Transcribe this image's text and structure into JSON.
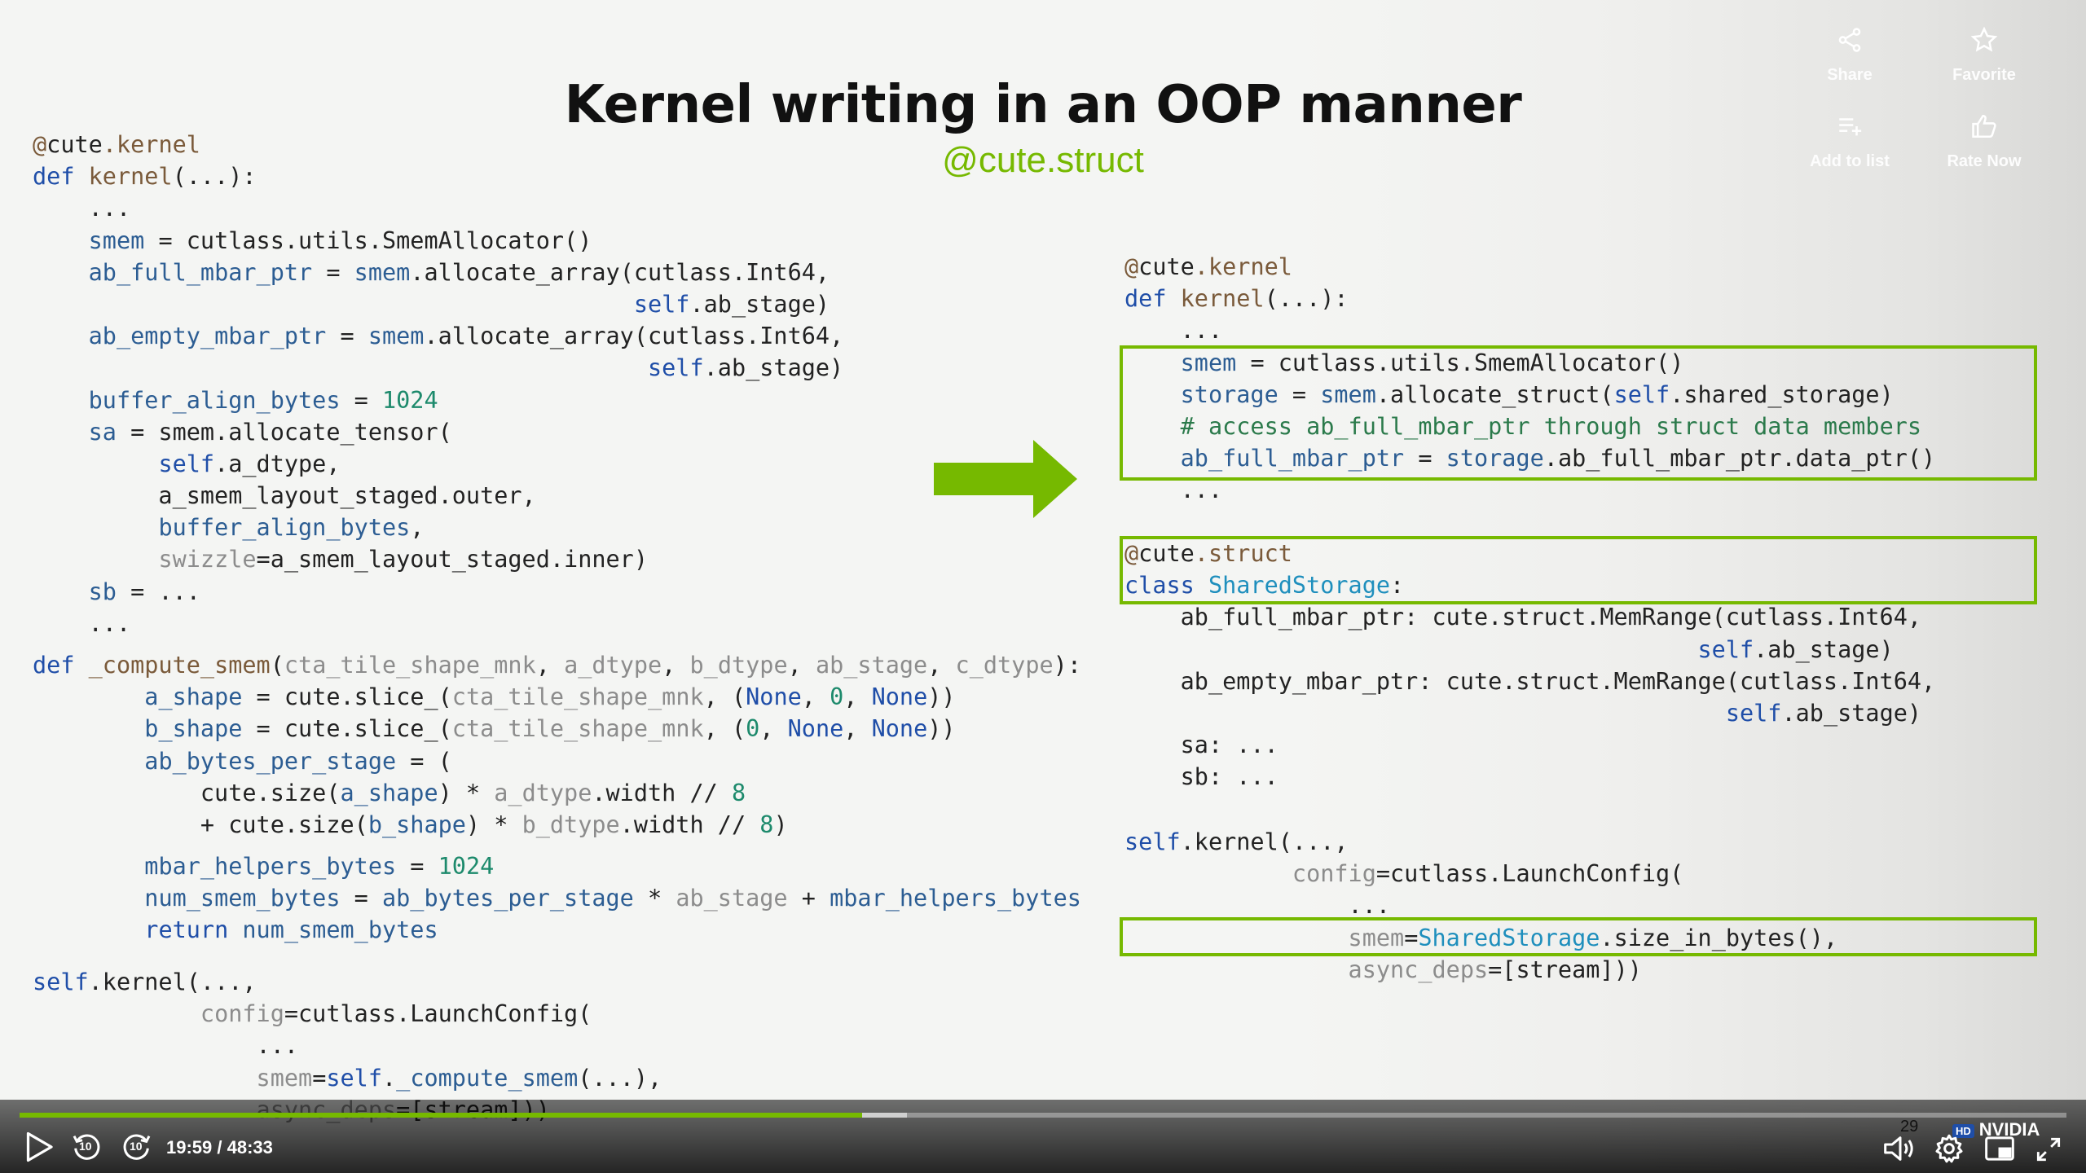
{
  "slide": {
    "title": "Kernel writing in an OOP manner",
    "subtitle": "@cute.struct",
    "number": "29"
  },
  "left_code": [
    [
      [
        "@",
        "c-dec"
      ],
      [
        "cute",
        "c-dec-none"
      ],
      [
        ".kernel",
        "c-dec"
      ]
    ],
    [
      [
        "def ",
        "c-kw"
      ],
      [
        "kernel",
        "c-fn"
      ],
      [
        "(...):",
        ""
      ]
    ],
    [
      [
        "    ...",
        ""
      ]
    ],
    [
      [
        "    ",
        ""
      ],
      [
        "smem",
        "c-var"
      ],
      [
        " = cutlass.utils.SmemAllocator()",
        ""
      ]
    ],
    [
      [
        "    ",
        ""
      ],
      [
        "ab_full_mbar_ptr",
        "c-var"
      ],
      [
        " = ",
        ""
      ],
      [
        "smem",
        "c-var"
      ],
      [
        ".allocate_array(cutlass.Int64,",
        ""
      ]
    ],
    [
      [
        "                                           ",
        ""
      ],
      [
        "self",
        "c-self"
      ],
      [
        ".ab_stage)",
        ""
      ]
    ],
    [
      [
        "    ",
        ""
      ],
      [
        "ab_empty_mbar_ptr",
        "c-var"
      ],
      [
        " = ",
        ""
      ],
      [
        "smem",
        "c-var"
      ],
      [
        ".allocate_array(cutlass.Int64,",
        ""
      ]
    ],
    [
      [
        "                                            ",
        ""
      ],
      [
        "self",
        "c-self"
      ],
      [
        ".ab_stage)",
        ""
      ]
    ],
    [
      [
        "    ",
        ""
      ],
      [
        "buffer_align_bytes",
        "c-var"
      ],
      [
        " = ",
        ""
      ],
      [
        "1024",
        "c-num"
      ]
    ],
    [
      [
        "    ",
        ""
      ],
      [
        "sa",
        "c-var"
      ],
      [
        " = smem.allocate_tensor(",
        ""
      ]
    ],
    [
      [
        "         ",
        ""
      ],
      [
        "self",
        "c-self"
      ],
      [
        ".a_dtype,",
        ""
      ]
    ],
    [
      [
        "         a_smem_layout_staged.outer,",
        ""
      ]
    ],
    [
      [
        "         ",
        ""
      ],
      [
        "buffer_align_bytes",
        "c-var"
      ],
      [
        ",",
        ""
      ]
    ],
    [
      [
        "         ",
        ""
      ],
      [
        "swizzle",
        "c-gray"
      ],
      [
        "=a_smem_layout_staged.inner)",
        ""
      ]
    ],
    [
      [
        "    ",
        ""
      ],
      [
        "sb",
        "c-var"
      ],
      [
        " = ...",
        ""
      ]
    ],
    [
      [
        "    ...",
        ""
      ]
    ]
  ],
  "left_code2": [
    [
      [
        "def ",
        "c-kw"
      ],
      [
        "_compute_smem",
        "c-fn"
      ],
      [
        "(",
        ""
      ],
      [
        "cta_tile_shape_mnk",
        "c-gray"
      ],
      [
        ", ",
        ""
      ],
      [
        "a_dtype",
        "c-gray"
      ],
      [
        ", ",
        ""
      ],
      [
        "b_dtype",
        "c-gray"
      ],
      [
        ", ",
        ""
      ],
      [
        "ab_stage",
        "c-gray"
      ],
      [
        ", ",
        ""
      ],
      [
        "c_dtype",
        "c-gray"
      ],
      [
        "):",
        ""
      ]
    ],
    [
      [
        "        ",
        ""
      ],
      [
        "a_shape",
        "c-var"
      ],
      [
        " = cute.slice_(",
        ""
      ],
      [
        "cta_tile_shape_mnk",
        "c-gray"
      ],
      [
        ", (",
        ""
      ],
      [
        "None",
        "c-kw"
      ],
      [
        ", ",
        ""
      ],
      [
        "0",
        "c-num"
      ],
      [
        ", ",
        ""
      ],
      [
        "None",
        "c-kw"
      ],
      [
        "))",
        ""
      ]
    ],
    [
      [
        "        ",
        ""
      ],
      [
        "b_shape",
        "c-var"
      ],
      [
        " = cute.slice_(",
        ""
      ],
      [
        "cta_tile_shape_mnk",
        "c-gray"
      ],
      [
        ", (",
        ""
      ],
      [
        "0",
        "c-num"
      ],
      [
        ", ",
        ""
      ],
      [
        "None",
        "c-kw"
      ],
      [
        ", ",
        ""
      ],
      [
        "None",
        "c-kw"
      ],
      [
        "))",
        ""
      ]
    ],
    [
      [
        "        ",
        ""
      ],
      [
        "ab_bytes_per_stage",
        "c-var"
      ],
      [
        " = (",
        ""
      ]
    ],
    [
      [
        "            cute.size(",
        ""
      ],
      [
        "a_shape",
        "c-var"
      ],
      [
        ") * ",
        ""
      ],
      [
        "a_dtype",
        "c-gray"
      ],
      [
        ".width // ",
        ""
      ],
      [
        "8",
        "c-num"
      ]
    ],
    [
      [
        "            + cute.size(",
        ""
      ],
      [
        "b_shape",
        "c-var"
      ],
      [
        ") * ",
        ""
      ],
      [
        "b_dtype",
        "c-gray"
      ],
      [
        ".width // ",
        ""
      ],
      [
        "8",
        "c-num"
      ],
      [
        ")",
        ""
      ]
    ]
  ],
  "left_code3": [
    [
      [
        "        ",
        ""
      ],
      [
        "mbar_helpers_bytes",
        "c-var"
      ],
      [
        " = ",
        ""
      ],
      [
        "1024",
        "c-num"
      ]
    ],
    [
      [
        "        ",
        ""
      ],
      [
        "num_smem_bytes",
        "c-var"
      ],
      [
        " = ",
        ""
      ],
      [
        "ab_bytes_per_stage",
        "c-var"
      ],
      [
        " * ",
        ""
      ],
      [
        "ab_stage",
        "c-gray"
      ],
      [
        " + ",
        ""
      ],
      [
        "mbar_helpers_bytes",
        "c-var"
      ]
    ],
    [
      [
        "        ",
        ""
      ],
      [
        "return ",
        "c-kw"
      ],
      [
        "num_smem_bytes",
        "c-var"
      ]
    ]
  ],
  "left_code4": [
    [
      [
        "self",
        "c-self"
      ],
      [
        ".kernel(...,",
        ""
      ]
    ],
    [
      [
        "            ",
        ""
      ],
      [
        "config",
        "c-gray"
      ],
      [
        "=cutlass.LaunchConfig(",
        ""
      ]
    ],
    [
      [
        "                ...",
        ""
      ]
    ],
    [
      [
        "                ",
        ""
      ],
      [
        "smem",
        "c-gray"
      ],
      [
        "=",
        ""
      ],
      [
        "self",
        "c-self"
      ],
      [
        ".",
        ""
      ],
      [
        "_compute_smem",
        "c-var"
      ],
      [
        "(...),",
        ""
      ]
    ],
    [
      [
        "                ",
        ""
      ],
      [
        "async_deps",
        "c-gray"
      ],
      [
        "=[stream]))",
        ""
      ]
    ]
  ],
  "right_code": [
    [
      [
        "@",
        "c-dec"
      ],
      [
        "cute",
        "c-dec-none"
      ],
      [
        ".kernel",
        "c-dec"
      ]
    ],
    [
      [
        "def ",
        "c-kw"
      ],
      [
        "kernel",
        "c-fn"
      ],
      [
        "(...):",
        ""
      ]
    ],
    [
      [
        "    ...",
        ""
      ]
    ],
    [
      [
        "    ",
        ""
      ],
      [
        "smem",
        "c-var"
      ],
      [
        " = cutlass.utils.SmemAllocator()",
        ""
      ]
    ],
    [
      [
        "    ",
        ""
      ],
      [
        "storage",
        "c-var"
      ],
      [
        " = ",
        ""
      ],
      [
        "smem",
        "c-var"
      ],
      [
        ".allocate_struct(",
        ""
      ],
      [
        "self",
        "c-self"
      ],
      [
        ".shared_storage)",
        ""
      ]
    ],
    [
      [
        "    ",
        ""
      ],
      [
        "# access ab_full_mbar_ptr through struct data members",
        "c-cmt"
      ]
    ],
    [
      [
        "    ",
        ""
      ],
      [
        "ab_full_mbar_ptr",
        "c-var"
      ],
      [
        " = ",
        ""
      ],
      [
        "storage",
        "c-var"
      ],
      [
        ".ab_full_mbar_ptr.data_ptr()",
        ""
      ]
    ],
    [
      [
        "    ...",
        ""
      ]
    ]
  ],
  "right_code2": [
    [
      [
        "@",
        "c-dec"
      ],
      [
        "cute",
        "c-dec-none"
      ],
      [
        ".struct",
        "c-dec"
      ]
    ],
    [
      [
        "class ",
        "c-kw"
      ],
      [
        "SharedStorage",
        "c-cls"
      ],
      [
        ":",
        ""
      ]
    ],
    [
      [
        "    ab_full_mbar_ptr: cute.struct.MemRange(cutlass.Int64,",
        ""
      ]
    ],
    [
      [
        "                                         ",
        ""
      ],
      [
        "self",
        "c-self"
      ],
      [
        ".ab_stage)",
        ""
      ]
    ],
    [
      [
        "    ab_empty_mbar_ptr: cute.struct.MemRange(cutlass.Int64,",
        ""
      ]
    ],
    [
      [
        "                                           ",
        ""
      ],
      [
        "self",
        "c-self"
      ],
      [
        ".ab_stage)",
        ""
      ]
    ],
    [
      [
        "    sa: ...",
        ""
      ]
    ],
    [
      [
        "    sb: ...",
        ""
      ]
    ]
  ],
  "right_code3": [
    [
      [
        "self",
        "c-self"
      ],
      [
        ".kernel(...,",
        ""
      ]
    ],
    [
      [
        "            ",
        ""
      ],
      [
        "config",
        "c-gray"
      ],
      [
        "=cutlass.LaunchConfig(",
        ""
      ]
    ],
    [
      [
        "                ...",
        ""
      ]
    ],
    [
      [
        "                ",
        ""
      ],
      [
        "smem",
        "c-gray"
      ],
      [
        "=",
        ""
      ],
      [
        "SharedStorage",
        "c-cls"
      ],
      [
        ".size_in_bytes(),",
        ""
      ]
    ],
    [
      [
        "                ",
        ""
      ],
      [
        "async_deps",
        "c-gray"
      ],
      [
        "=[stream]))",
        ""
      ]
    ]
  ],
  "player": {
    "share_label": "Share",
    "favorite_label": "Favorite",
    "add_to_list_label": "Add to list",
    "rate_now_label": "Rate Now",
    "time": "19:59 / 48:33",
    "progress_fraction": 0.4117,
    "buffer_fraction": 0.4335,
    "hd_badge": "HD",
    "brand": "NVIDIA",
    "skip_back_seconds": "10",
    "skip_forward_seconds": "10",
    "accent": "#76b900"
  },
  "icons": [
    "share-icon",
    "star-icon",
    "add-to-list-icon",
    "thumbs-up-icon",
    "play-icon",
    "replay-10-icon",
    "forward-10-icon",
    "volume-icon",
    "settings-icon",
    "picture-in-picture-icon",
    "fullscreen-icon"
  ]
}
